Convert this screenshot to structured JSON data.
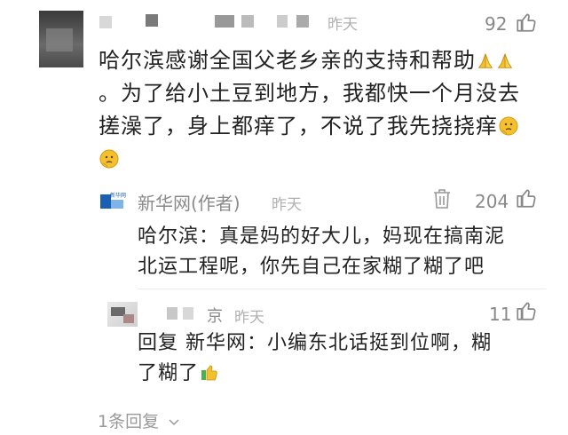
{
  "top_comment": {
    "time": "昨天",
    "like_count": "92",
    "text_line1": "哈尔滨感谢全国父老乡亲的支持和帮助",
    "text_line2": "。为了给小土豆到地方，我都快一个月没去",
    "text_line3": "搓澡了，身上都痒了，不说了我先挠挠痒"
  },
  "reply_xinhua": {
    "author": "新华网(作者)",
    "time": "昨天",
    "like_count": "204",
    "logo_text": "新华网",
    "text_line1": "哈尔滨：真是妈的好大儿，妈现在搞南泥",
    "text_line2": "北运工程呢，你先自己在家糊了糊了吧"
  },
  "reply_user": {
    "name_suffix": "京",
    "time": "昨天",
    "like_count": "11",
    "text_line1": "回复 新华网：小编东北话挺到位啊，糊",
    "text_line2": "了糊了"
  },
  "footer": {
    "replies_label": "1条回复"
  },
  "colors": {
    "text": "#222222",
    "muted": "#8a8a8a",
    "emoji_yellow": "#f5c02e",
    "xinhua_blue": "#1a5fb4"
  }
}
